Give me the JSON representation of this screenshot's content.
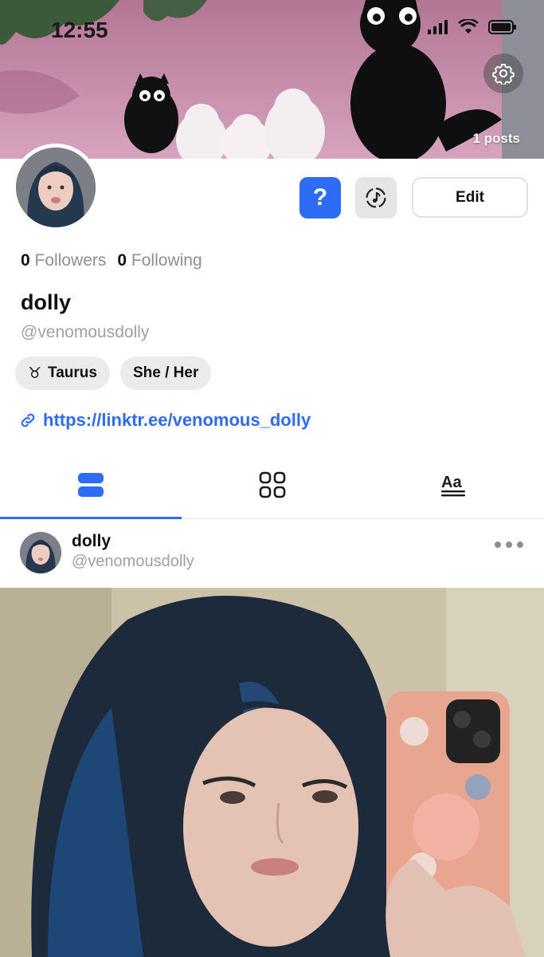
{
  "status_bar": {
    "time": "12:55"
  },
  "banner": {
    "posts_count": "1 posts"
  },
  "profile": {
    "followers_count": "0",
    "followers_label": "Followers",
    "following_count": "0",
    "following_label": "Following",
    "display_name": "dolly",
    "handle": "@venomousdolly",
    "chips": [
      {
        "icon": "taurus-icon",
        "glyph": "♉",
        "label": "Taurus"
      },
      {
        "label": "She / Her"
      }
    ],
    "link": "https://linktr.ee/venomous_dolly"
  },
  "actions": {
    "help_label": "?",
    "edit_label": "Edit"
  },
  "tabs": [
    {
      "icon": "list-view-icon",
      "active": true
    },
    {
      "icon": "grid-view-icon",
      "active": false
    },
    {
      "icon": "text-posts-icon",
      "active": false
    }
  ],
  "post": {
    "author_name": "dolly",
    "author_handle": "@venomousdolly"
  },
  "colors": {
    "accent": "#2f6cf5",
    "muted_text": "#8f8f94",
    "chip_bg": "#ebebee"
  }
}
